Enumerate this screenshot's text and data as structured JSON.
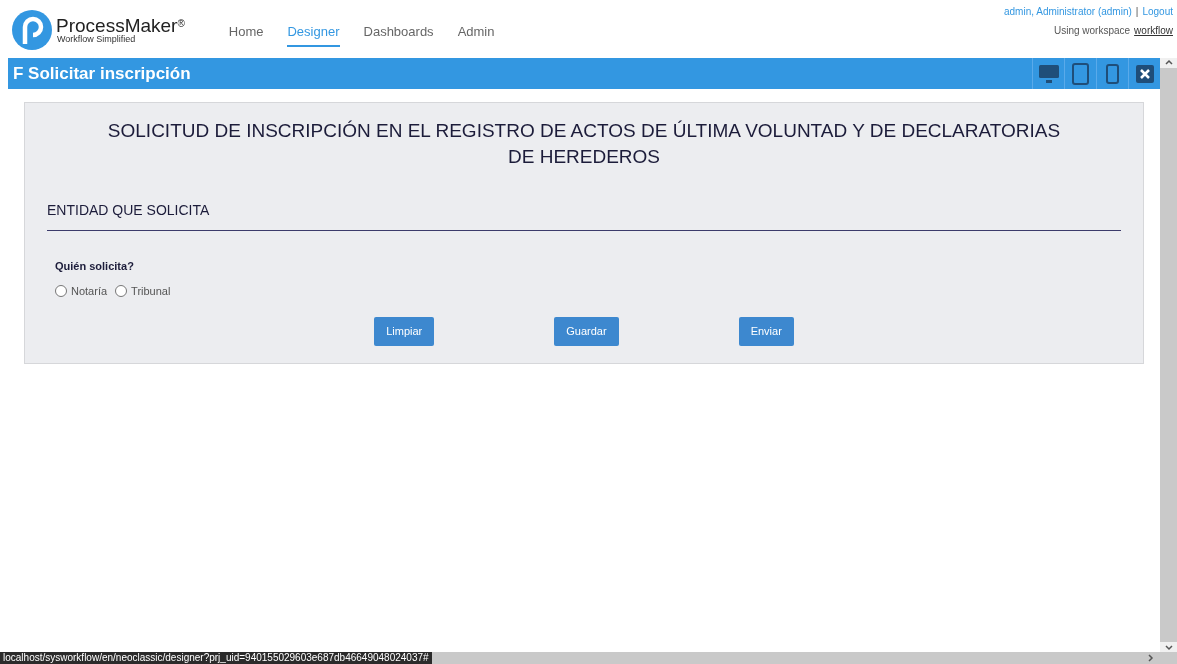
{
  "logo": {
    "name": "ProcessMaker",
    "mark": "®",
    "tagline": "Workflow Simplified"
  },
  "nav": [
    {
      "label": "Home",
      "selected": false
    },
    {
      "label": "Designer",
      "selected": true
    },
    {
      "label": "Dashboards",
      "selected": false
    },
    {
      "label": "Admin",
      "selected": false
    }
  ],
  "user": {
    "name": "admin, Administrator (admin)",
    "separator": "|",
    "logout": "Logout",
    "workspace_label": "Using workspace",
    "workspace": "workflow"
  },
  "form_bar": {
    "title": "F Solicitar inscripción",
    "tools": [
      {
        "kind": "desktop"
      },
      {
        "kind": "tablet"
      },
      {
        "kind": "phone"
      },
      {
        "kind": "close"
      }
    ]
  },
  "form": {
    "title": "SOLICITUD DE INSCRIPCIÓN EN EL REGISTRO DE ACTOS DE ÚLTIMA VOLUNTAD Y DE DECLARATORIAS DE HEREDEROS",
    "section": "ENTIDAD QUE SOLICITA",
    "question": "Quién solicita?",
    "options": [
      {
        "label": "Notaría",
        "selected": false
      },
      {
        "label": "Tribunal",
        "selected": false
      }
    ],
    "buttons": [
      "Limpiar",
      "Guardar",
      "Enviar"
    ]
  },
  "status_url": "localhost/sysworkflow/en/neoclassic/designer?prj_uid=940155029603e687db46649048024037#"
}
